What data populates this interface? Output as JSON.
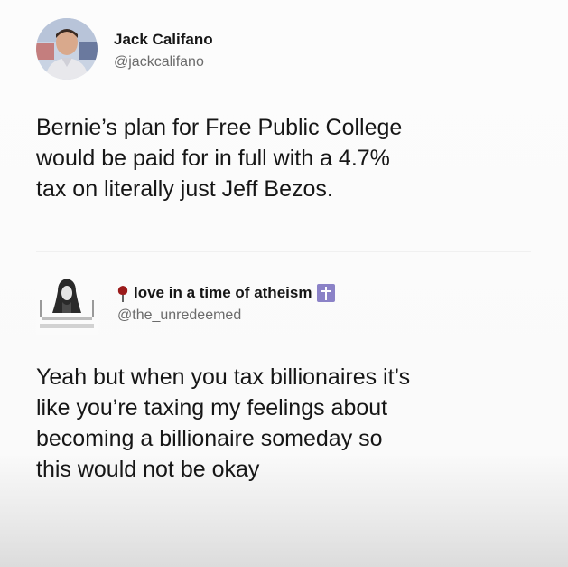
{
  "tweets": [
    {
      "author_name": "Jack Califano",
      "handle": "@jackcalifano",
      "avatar_icon": "person-photo-avatar",
      "body_lines": [
        "Bernie’s plan for Free Public College",
        "would be paid for in full with a 4.7%",
        "tax on literally just Jeff Bezos."
      ]
    },
    {
      "author_name": "love in a time of atheism",
      "name_prefix_icon": "rose-icon",
      "name_suffix_icon": "cross-icon",
      "handle": "@the_unredeemed",
      "avatar_icon": "drawn-figure-avatar",
      "body_lines": [
        "Yeah but when you tax billionaires it’s",
        "like you’re taxing my feelings about",
        "becoming a billionaire someday so",
        "this would not be okay"
      ]
    }
  ],
  "colors": {
    "text": "#161616",
    "handle": "#6b6b6b",
    "rose": "#9b1b1b",
    "cross_badge": "#8b82c7"
  }
}
